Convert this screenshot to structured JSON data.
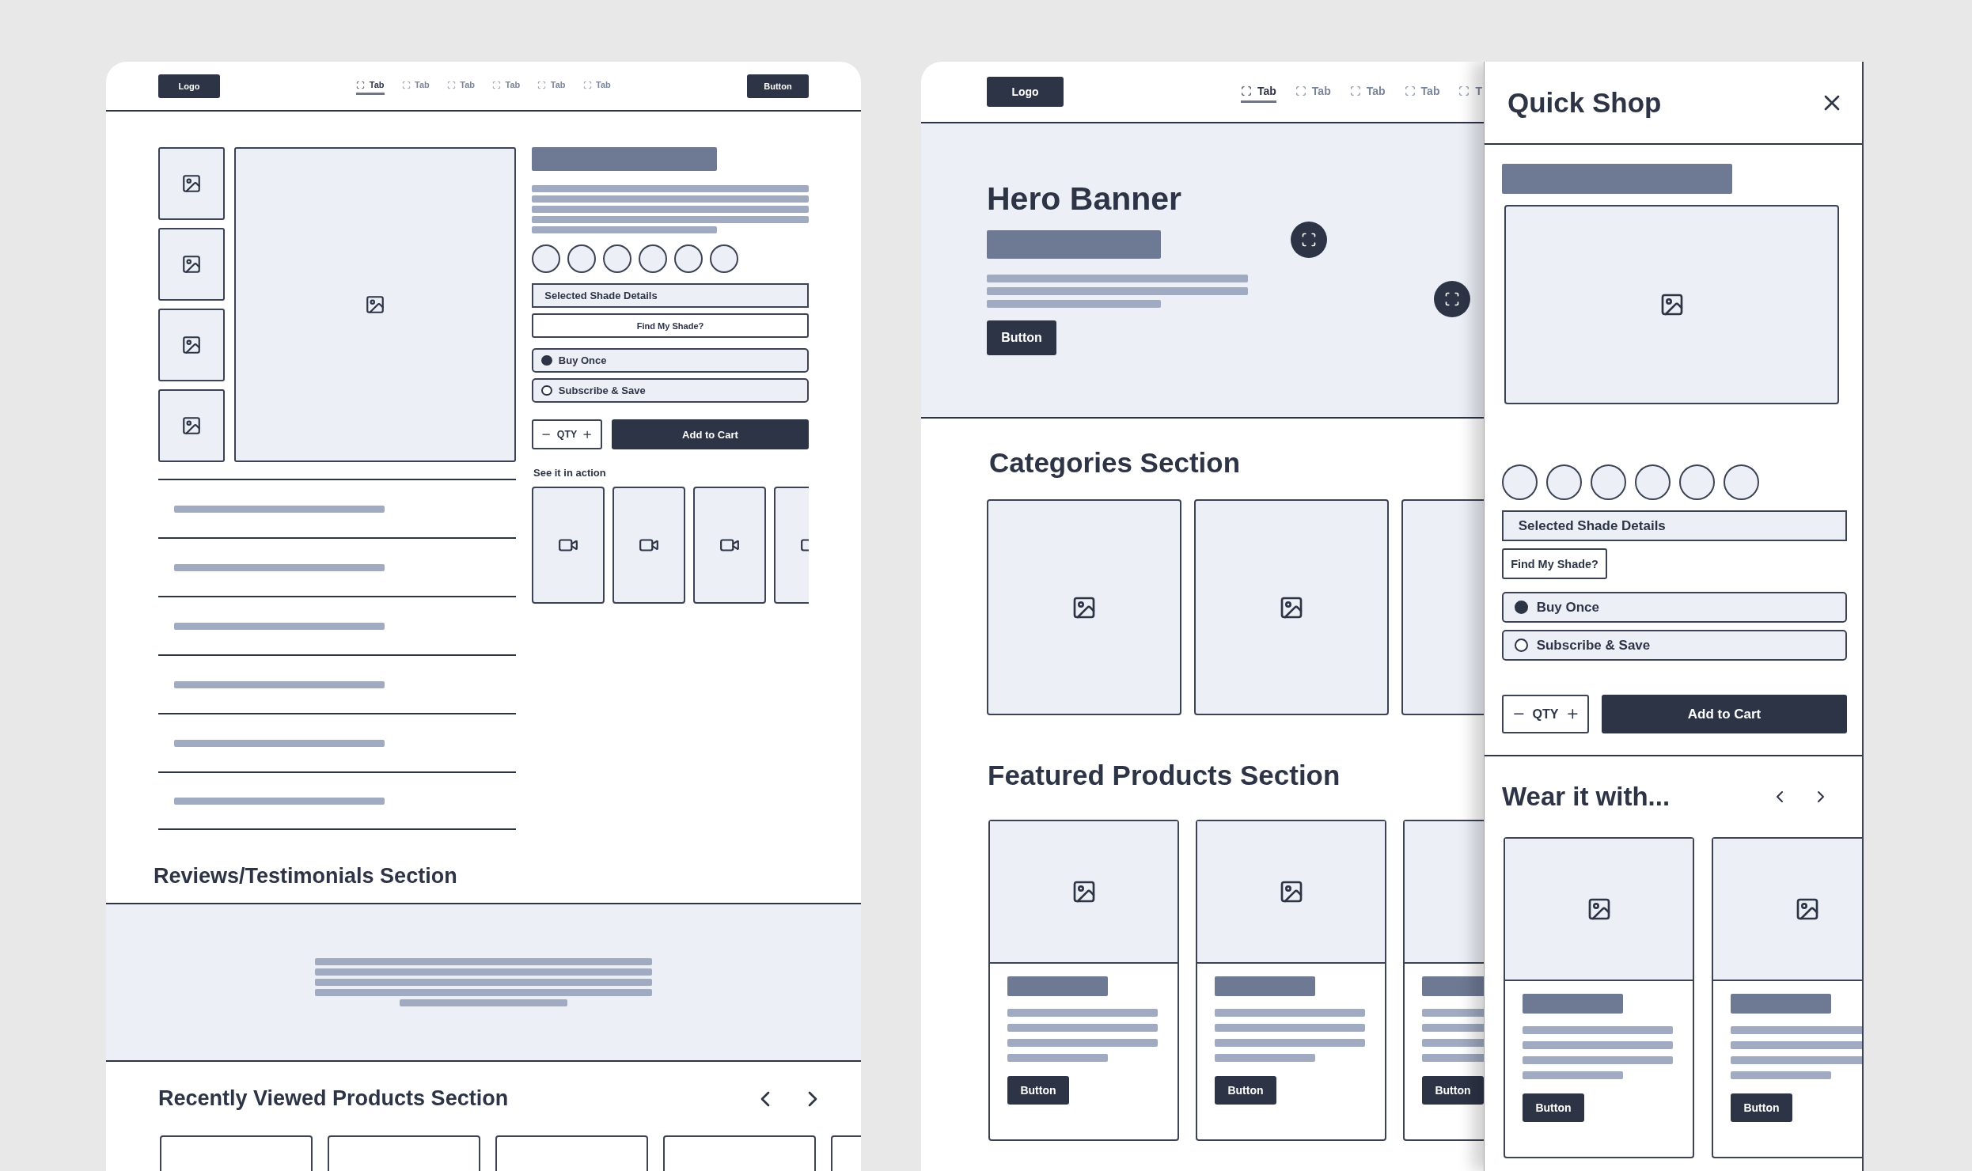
{
  "left_page": {
    "header": {
      "logo": "Logo",
      "tabs": [
        {
          "label": "Tab",
          "selected": true
        },
        {
          "label": "Tab",
          "selected": false
        },
        {
          "label": "Tab",
          "selected": false
        },
        {
          "label": "Tab",
          "selected": false
        },
        {
          "label": "Tab",
          "selected": false
        },
        {
          "label": "Tab",
          "selected": false
        }
      ],
      "button": "Button"
    },
    "product": {
      "shade_details": "Selected Shade Details",
      "find_shade": "Find My Shade?",
      "purchase_options": [
        {
          "label": "Buy Once",
          "selected": true
        },
        {
          "label": "Subscribe & Save",
          "selected": false
        }
      ],
      "qty": "QTY",
      "add_to_cart": "Add to Cart",
      "videos_title": "See it in action"
    },
    "reviews_title": "Reviews/Testimonials Section",
    "recently_viewed_title": "Recently Viewed Products Section"
  },
  "right_page": {
    "header": {
      "logo": "Logo",
      "tabs": [
        {
          "label": "Tab",
          "selected": true
        },
        {
          "label": "Tab",
          "selected": false
        },
        {
          "label": "Tab",
          "selected": false
        },
        {
          "label": "Tab",
          "selected": false
        },
        {
          "label": "T",
          "selected": false
        }
      ]
    },
    "hero": {
      "title": "Hero Banner",
      "button": "Button"
    },
    "categories_title": "Categories Section",
    "featured": {
      "title": "Featured Products Section",
      "products": [
        {
          "button": "Button"
        },
        {
          "button": "Button"
        },
        {
          "button": "Button"
        }
      ]
    }
  },
  "quick_shop": {
    "title": "Quick Shop",
    "shade_details": "Selected Shade Details",
    "find_shade": "Find My Shade?",
    "purchase_options": [
      {
        "label": "Buy Once",
        "selected": true
      },
      {
        "label": "Subscribe & Save",
        "selected": false
      }
    ],
    "qty": "QTY",
    "add_to_cart": "Add to Cart",
    "wear_with": {
      "title": "Wear it with...",
      "products": [
        {
          "button": "Button"
        },
        {
          "button": "Button"
        }
      ]
    }
  }
}
